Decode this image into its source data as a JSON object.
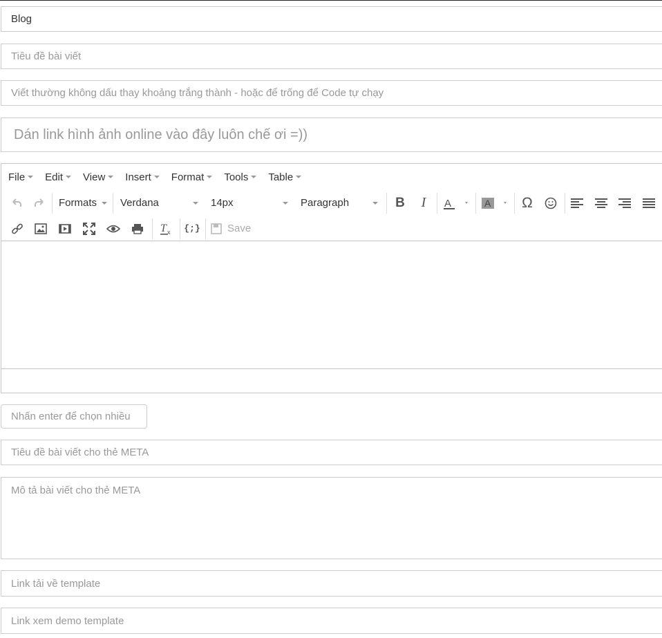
{
  "fields": {
    "category_value": "Blog",
    "title_placeholder": "Tiêu đề bài viết",
    "slug_placeholder": "Viết thường không dấu thay khoảng trắng thành - hoặc để trống để Code tự chạy",
    "image_placeholder": "Dán link hình ảnh online vào đây luôn chế ơi =))",
    "tags_placeholder": "Nhấn enter để chọn nhiều",
    "meta_title_placeholder": "Tiêu đề bài viết cho thẻ META",
    "meta_desc_placeholder": "Mô tả bài viết cho thẻ META",
    "download_placeholder": "Link tải về template",
    "demo_placeholder": "Link xem demo template"
  },
  "editor": {
    "menu": [
      "File",
      "Edit",
      "View",
      "Insert",
      "Format",
      "Tools",
      "Table"
    ],
    "formats_label": "Formats",
    "font_family": "Verdana",
    "font_size": "14px",
    "block_format": "Paragraph",
    "save_label": "Save",
    "icons": [
      "undo-icon",
      "redo-icon",
      "bold-icon",
      "italic-icon",
      "text-color-icon",
      "background-color-icon",
      "special-char-icon",
      "emoticon-icon",
      "align-left-icon",
      "align-center-icon",
      "align-right-icon",
      "align-justify-icon",
      "link-icon",
      "image-icon",
      "media-icon",
      "fullscreen-icon",
      "preview-icon",
      "print-icon",
      "clear-format-icon",
      "code-sample-icon",
      "save-icon"
    ]
  }
}
